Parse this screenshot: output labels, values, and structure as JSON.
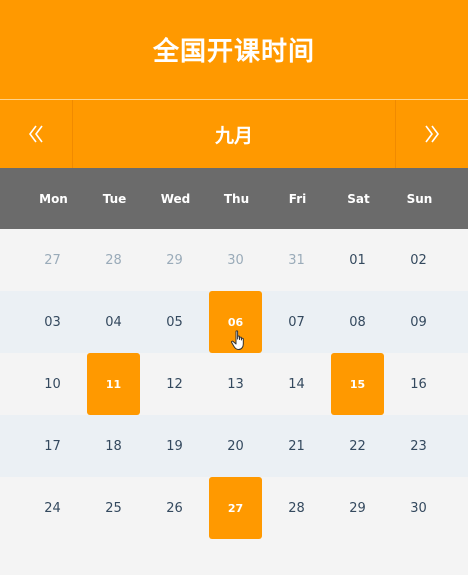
{
  "header": {
    "title": "全国开课时间"
  },
  "nav": {
    "month": "九月",
    "prev_icon": "chevron-double-left-icon",
    "next_icon": "chevron-double-right-icon"
  },
  "colors": {
    "accent": "#ff9900",
    "weekday_bar": "#6b6b6b",
    "row_alt": "#ebf0f4",
    "row_plain": "#f4f4f4"
  },
  "weekdays": [
    "Mon",
    "Tue",
    "Wed",
    "Thu",
    "Fri",
    "Sat",
    "Sun"
  ],
  "weeks": [
    [
      "27",
      "28",
      "29",
      "30",
      "31",
      "01",
      "02"
    ],
    [
      "03",
      "04",
      "05",
      "06",
      "07",
      "08",
      "09"
    ],
    [
      "10",
      "11",
      "12",
      "13",
      "14",
      "15",
      "16"
    ],
    [
      "17",
      "18",
      "19",
      "20",
      "21",
      "22",
      "23"
    ],
    [
      "24",
      "25",
      "26",
      "27",
      "28",
      "29",
      "30"
    ]
  ],
  "outside_month_days": [
    "27",
    "28",
    "29",
    "30",
    "31"
  ],
  "highlighted_days": [
    "06",
    "11",
    "15",
    "27"
  ],
  "cursor_icon": "hand-pointer-icon"
}
